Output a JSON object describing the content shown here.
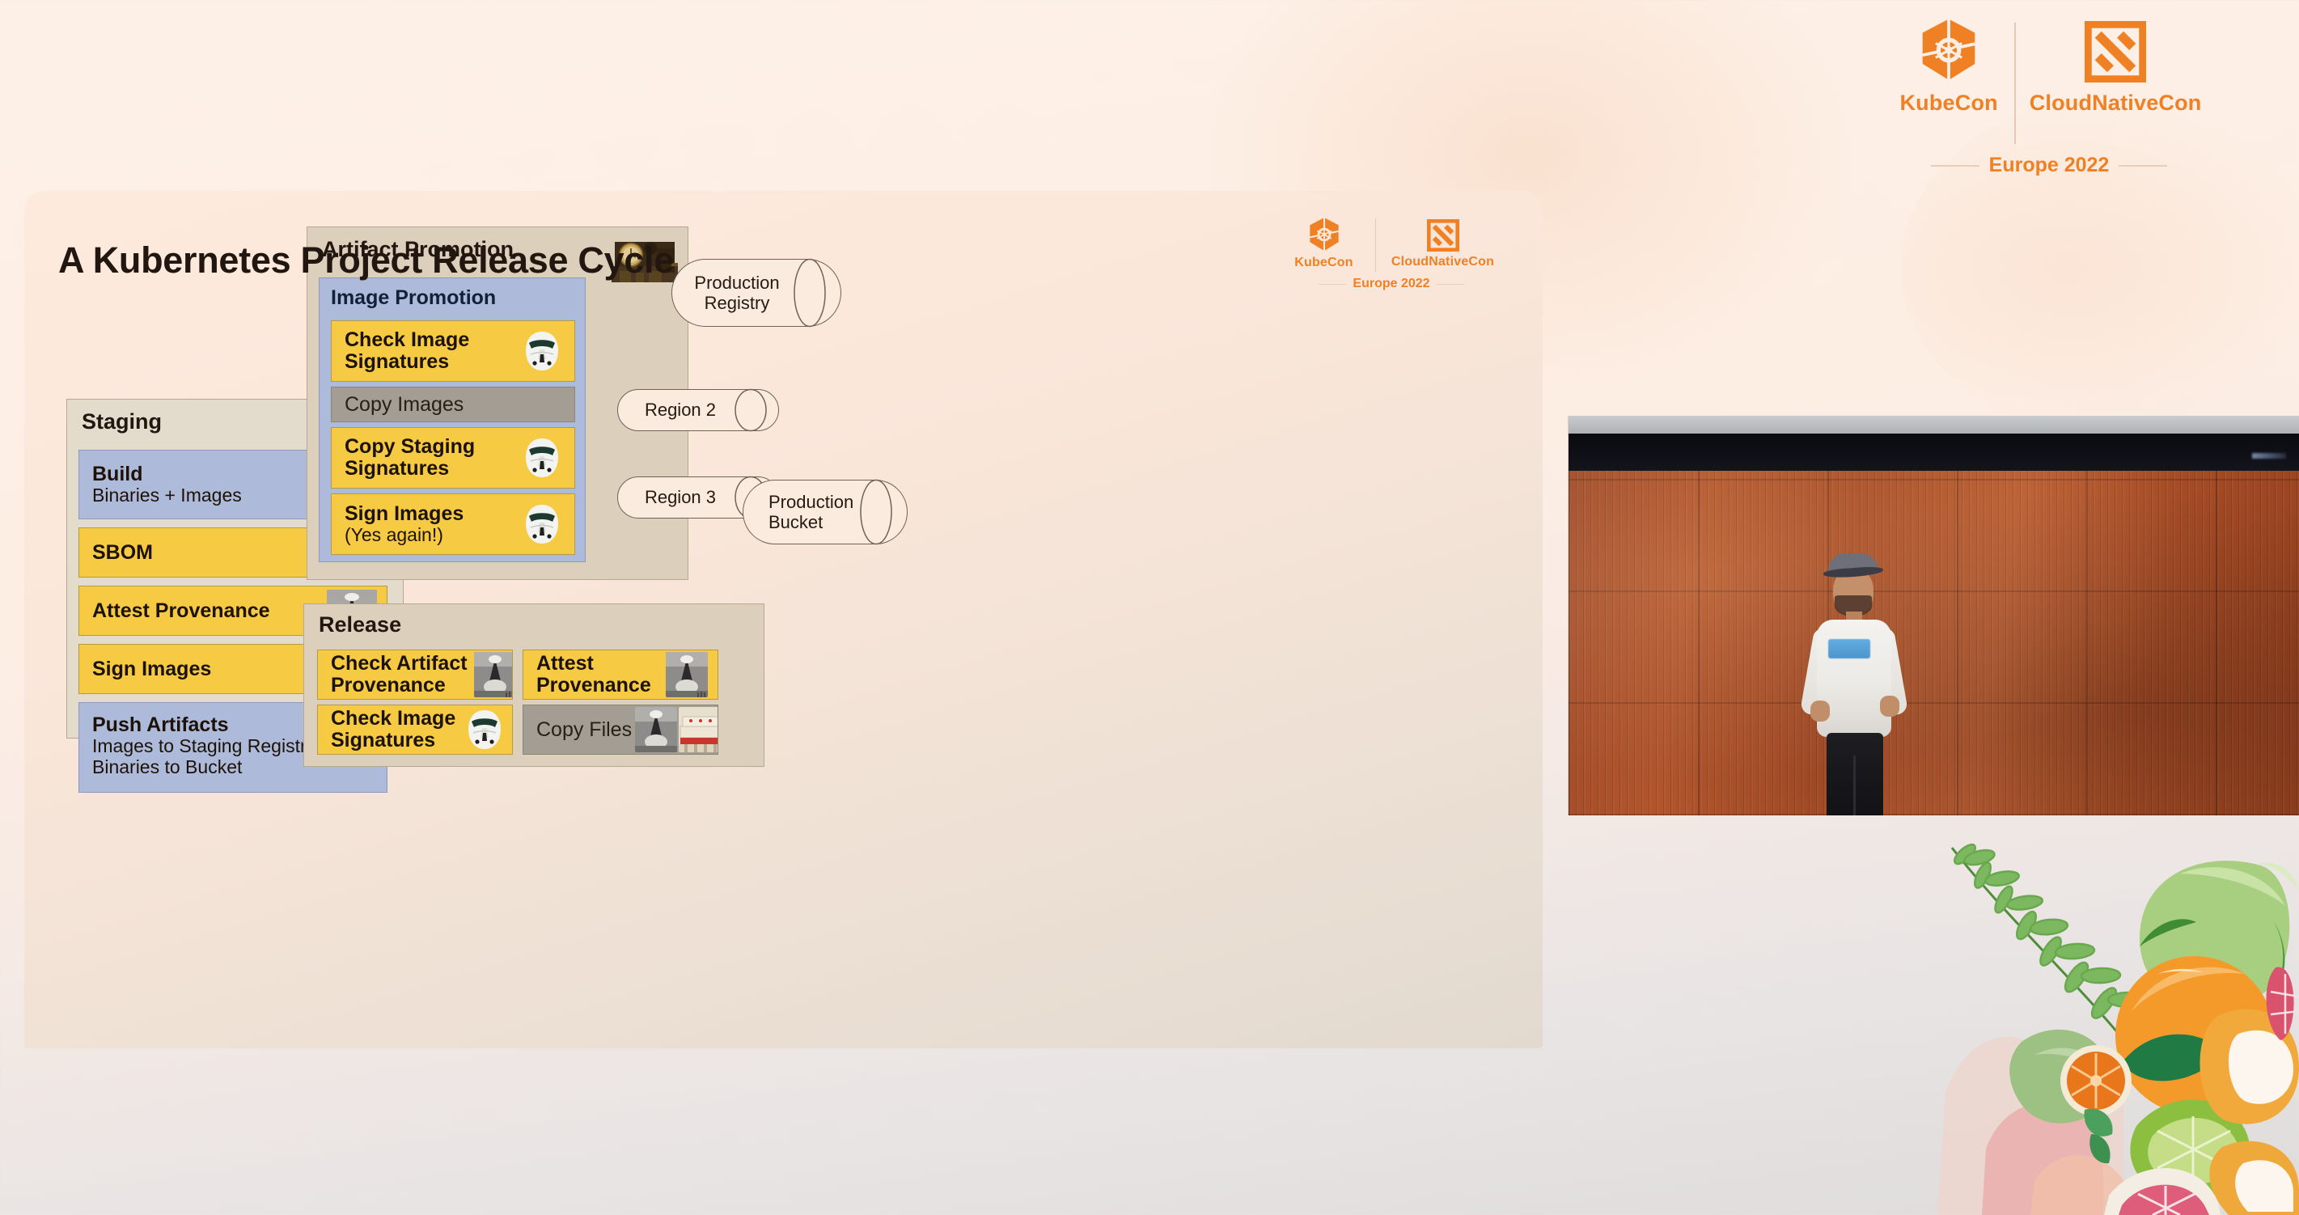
{
  "brand": {
    "kubecon_label": "KubeCon",
    "cloudnativecon_label": "CloudNativeCon",
    "location_label": "Europe 2022",
    "accent_color": "#ef8024",
    "k8s_icon": "kubernetes-helm-icon",
    "cncf_icon": "cloudnativecon-square-icon"
  },
  "slide": {
    "title": "A Kubernetes Project Release Cycle",
    "background_color": "#fbe7da",
    "panel_fill": "#dccfbb",
    "chip_yellow": "#f6cb43",
    "chip_blue": "#aebada",
    "chip_gray": "#a49d93",
    "arrow_color": "#38404f"
  },
  "staging": {
    "title": "Staging",
    "steps": [
      {
        "title": "Build",
        "subtitle": "Binaries + Images",
        "style": "blue",
        "icon": ""
      },
      {
        "title": "SBOM",
        "subtitle": "",
        "style": "yellow",
        "icon": "temple-photo"
      },
      {
        "title": "Attest Provenance",
        "subtitle": "",
        "style": "yellow",
        "icon": "wizard-photo"
      },
      {
        "title": "Sign Images",
        "subtitle": "",
        "style": "yellow",
        "icon": "stormtrooper-photo"
      },
      {
        "title": "Push Artifacts",
        "subtitle": "Images to Staging Registry",
        "subtitle2": "Binaries to Bucket",
        "style": "blue",
        "icon": ""
      }
    ]
  },
  "artifact_promotion": {
    "title": "Artifact Promotion",
    "header_icon": "antique-machinery-photo",
    "image_promotion": {
      "title": "Image Promotion",
      "steps": [
        {
          "title": "Check Image",
          "subtitle": "Signatures",
          "style": "yellow",
          "icon": "stormtrooper-photo"
        },
        {
          "title": "Copy Images",
          "subtitle": "",
          "style": "gray",
          "icon": ""
        },
        {
          "title": "Copy Staging",
          "subtitle": "Signatures",
          "style": "yellow",
          "icon": "stormtrooper-photo"
        },
        {
          "title": "Sign Images",
          "subtitle": "(Yes again!)",
          "style": "yellow",
          "icon": "stormtrooper-photo"
        }
      ]
    }
  },
  "release": {
    "title": "Release",
    "steps": [
      {
        "title": "Check Artifact",
        "subtitle": "Provenance",
        "style": "yellow",
        "icon": "wizard-photo"
      },
      {
        "title": "Attest",
        "subtitle": "Provenance",
        "style": "yellow",
        "icon": "wizard-photo"
      },
      {
        "title": "Check Image",
        "subtitle": "Signatures",
        "style": "yellow",
        "icon": "stormtrooper-photo"
      },
      {
        "title": "Copy Files",
        "subtitle": "",
        "style": "gray",
        "icon": "wizard-and-temple-photo"
      }
    ]
  },
  "datastores": [
    {
      "line1": "Production",
      "line2": "Registry",
      "name": "production-registry"
    },
    {
      "line1": "Region 2",
      "line2": "",
      "name": "region-2"
    },
    {
      "line1": "Region 3",
      "line2": "",
      "name": "region-3"
    },
    {
      "line1": "Production",
      "line2": "Bucket",
      "name": "production-bucket"
    }
  ],
  "video_feed": {
    "scene": "conference-stage-speaker",
    "shirt_logo": "space-guard-tshirt-graphic"
  },
  "decoration": {
    "fruit_illustration": "watercolor-citrus-fruit-illustration"
  }
}
